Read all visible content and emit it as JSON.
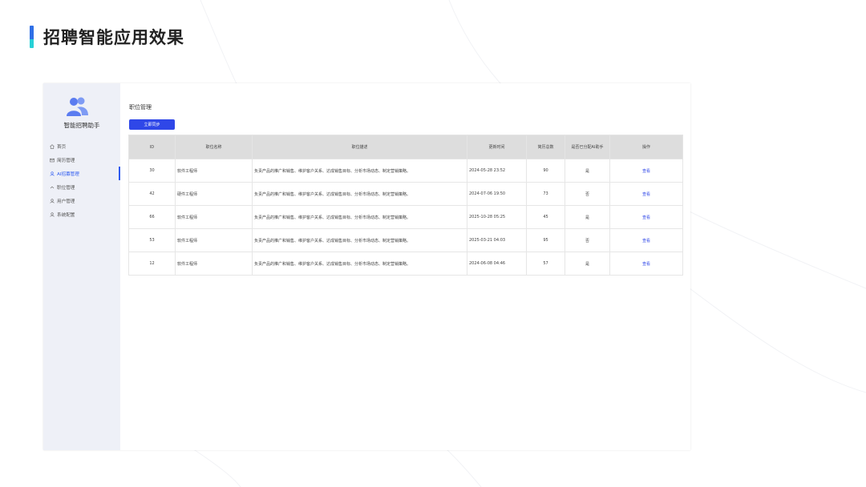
{
  "slide": {
    "title": "招聘智能应用效果"
  },
  "sidebar": {
    "brand": "智能招聘助手",
    "items": [
      {
        "label": "首页",
        "icon": "home-icon"
      },
      {
        "label": "简历管理",
        "icon": "mail-icon"
      },
      {
        "label": "AI招募管理",
        "icon": "user-icon",
        "active": true
      },
      {
        "label": "职位管理",
        "icon": "chevron-up-icon"
      },
      {
        "label": "用户管理",
        "icon": "user-icon"
      },
      {
        "label": "系统配置",
        "icon": "user-icon"
      }
    ]
  },
  "main": {
    "heading": "职位管理",
    "sync_button": "立即同步",
    "columns": [
      "ID",
      "职位名称",
      "职位描述",
      "更新时间",
      "简历总数",
      "是否已分配AI助手",
      "操作"
    ],
    "rows": [
      {
        "id": "30",
        "name": "软件工程师",
        "desc": "负责产品的推广和销售、维护客户关系、达成销售目标、分析市场动态、制定营销策略。",
        "updated": "2024-05-28 23:52",
        "count": "90",
        "assigned": "是",
        "action": "查看"
      },
      {
        "id": "42",
        "name": "硬件工程师",
        "desc": "负责产品的推广和销售、维护客户关系、达成销售目标、分析市场动态、制定营销策略。",
        "updated": "2024-07-06 19:50",
        "count": "73",
        "assigned": "否",
        "action": "查看"
      },
      {
        "id": "66",
        "name": "软件工程师",
        "desc": "负责产品的推广和销售、维护客户关系、达成销售目标、分析市场动态、制定营销策略。",
        "updated": "2025-10-28 05:25",
        "count": "45",
        "assigned": "是",
        "action": "查看"
      },
      {
        "id": "53",
        "name": "软件工程师",
        "desc": "负责产品的推广和销售、维护客户关系、达成销售目标、分析市场动态、制定营销策略。",
        "updated": "2025-03-21 04:03",
        "count": "95",
        "assigned": "否",
        "action": "查看"
      },
      {
        "id": "12",
        "name": "软件工程师",
        "desc": "负责产品的推广和销售、维护客户关系、达成销售目标、分析市场动态、制定营销策略。",
        "updated": "2024-06-08 04:46",
        "count": "57",
        "assigned": "是",
        "action": "查看"
      }
    ]
  },
  "colors": {
    "accent": "#2f47e8",
    "sidebar_bg": "#eef0f7",
    "header_bg": "#dddddd"
  }
}
